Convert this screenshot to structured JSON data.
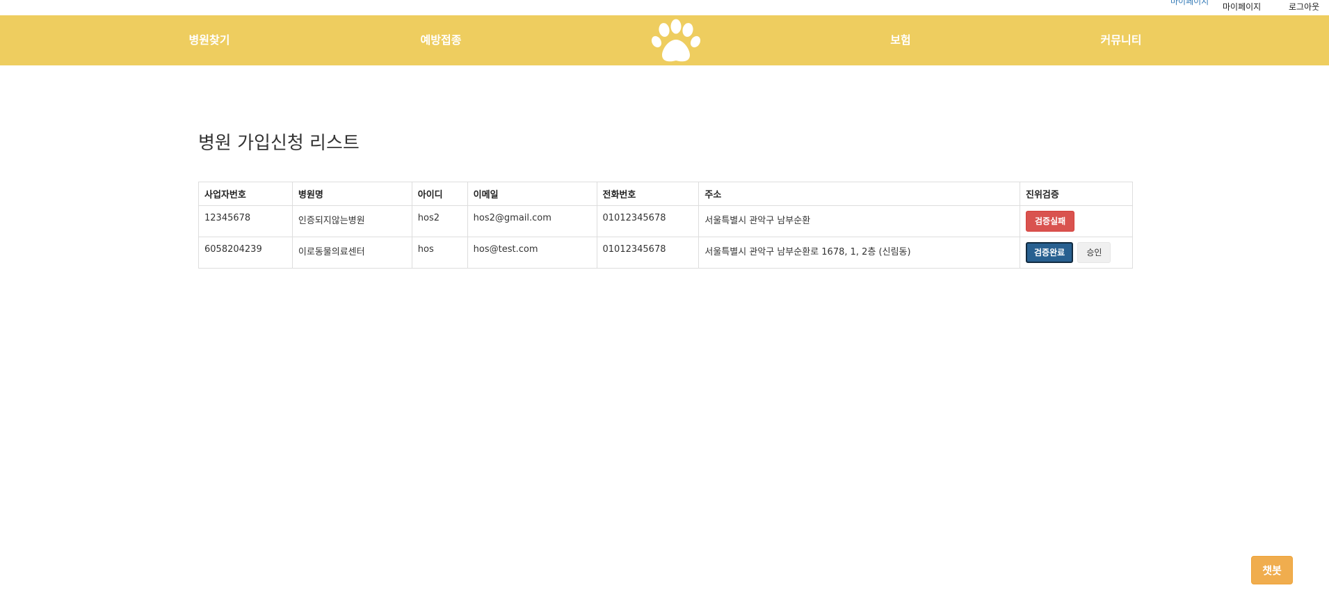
{
  "top_links": {
    "highlight": "마이페이지",
    "mypage": "마이페이지",
    "logout": "로그아웃"
  },
  "nav": {
    "items": [
      {
        "label": "병원찾기"
      },
      {
        "label": "예방접종"
      },
      {
        "label": "보험"
      },
      {
        "label": "커뮤니티"
      }
    ],
    "logo_icon": "paw-icon",
    "bg_color": "#eecd5f"
  },
  "page_title": "병원 가입신청 리스트",
  "table": {
    "headers": [
      "사업자번호",
      "병원명",
      "아이디",
      "이메일",
      "전화번호",
      "주소",
      "진위검증"
    ],
    "rows": [
      {
        "biz_no": "12345678",
        "name": "인증되지않는병원",
        "id": "hos2",
        "email": "hos2@gmail.com",
        "phone": "01012345678",
        "address": "서울특별시 관악구 남부순환",
        "verify_label": "검증실패"
      },
      {
        "biz_no": "6058204239",
        "name": "이로동물의료센터",
        "id": "hos",
        "email": "hos@test.com",
        "phone": "01012345678",
        "address": "서울특별시 관악구 남부순환로 1678, 1, 2층 (신림동)",
        "verify_label": "검증완료",
        "approve_label": "승인"
      }
    ]
  },
  "chatbot_label": "챗봇",
  "colors": {
    "danger": "#d9534f",
    "primary": "#286090",
    "warning": "#f0ad4e"
  }
}
